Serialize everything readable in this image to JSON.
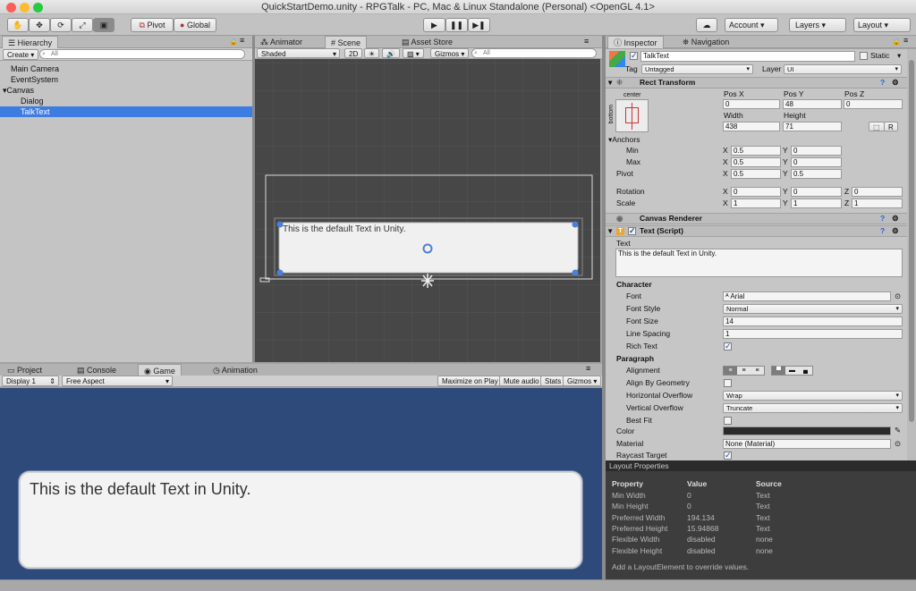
{
  "window": {
    "title": "QuickStartDemo.unity - RPGTalk - PC, Mac & Linux Standalone (Personal) <OpenGL 4.1>"
  },
  "toolbar": {
    "tools": [
      "hand-tool-icon",
      "move-tool-icon",
      "rotate-tool-icon",
      "scale-tool-icon",
      "rect-tool-icon"
    ],
    "pivot_label": "Pivot",
    "global_label": "Global",
    "play_icon": "▶",
    "pause_icon": "❚❚",
    "step_icon": "▶❚",
    "account_label": "Account",
    "layers_label": "Layers",
    "layout_label": "Layout"
  },
  "hierarchy": {
    "tab": "Hierarchy",
    "create_label": "Create",
    "search_placeholder": "All",
    "items": [
      {
        "label": "Main Camera"
      },
      {
        "label": "EventSystem"
      },
      {
        "label": "Canvas"
      },
      {
        "label": "Dialog"
      },
      {
        "label": "TalkText"
      }
    ]
  },
  "scene": {
    "tabs": [
      "Animator",
      "Scene",
      "Asset Store"
    ],
    "shading": "Shaded",
    "mode_2d": "2D",
    "gizmos_label": "Gizmos",
    "search_placeholder": "All",
    "text": "This is the default Text in Unity."
  },
  "bottom_tabs": [
    "Project",
    "Console",
    "Game",
    "Animation"
  ],
  "game": {
    "display": "Display 1",
    "aspect": "Free Aspect",
    "maximize": "Maximize on Play",
    "mute": "Mute audio",
    "stats": "Stats",
    "gizmos": "Gizmos",
    "text": "This is the default Text in Unity."
  },
  "inspector": {
    "tabs": [
      "Inspector",
      "Navigation"
    ],
    "object_name": "TalkText",
    "static_label": "Static",
    "tag_label": "Tag",
    "tag_value": "Untagged",
    "layer_label": "Layer",
    "layer_value": "UI",
    "rect_transform": {
      "title": "Rect Transform",
      "anchor_h": "center",
      "anchor_v": "bottom",
      "pos_x_label": "Pos X",
      "pos_y_label": "Pos Y",
      "pos_z_label": "Pos Z",
      "pos_x": "0",
      "pos_y": "48",
      "pos_z": "0",
      "width_label": "Width",
      "height_label": "Height",
      "width": "438",
      "height": "71",
      "r_label": "R",
      "anchors_label": "Anchors",
      "min_label": "Min",
      "max_label": "Max",
      "pivot_label": "Pivot",
      "min_x": "0.5",
      "min_y": "0",
      "max_x": "0.5",
      "max_y": "0",
      "pivot_x": "0.5",
      "pivot_y": "0.5",
      "rotation_label": "Rotation",
      "scale_label": "Scale",
      "rot_x": "0",
      "rot_y": "0",
      "rot_z": "0",
      "scale_x": "1",
      "scale_y": "1",
      "scale_z": "1",
      "x": "X",
      "y": "Y",
      "z": "Z"
    },
    "canvas_renderer": {
      "title": "Canvas Renderer"
    },
    "text_script": {
      "title": "Text (Script)",
      "text_label": "Text",
      "text_value": "This is the default Text in Unity.",
      "character_label": "Character",
      "font_label": "Font",
      "font_value": "Arial",
      "font_style_label": "Font Style",
      "font_style_value": "Normal",
      "font_size_label": "Font Size",
      "font_size_value": "14",
      "line_spacing_label": "Line Spacing",
      "line_spacing_value": "1",
      "rich_text_label": "Rich Text",
      "paragraph_label": "Paragraph",
      "alignment_label": "Alignment",
      "align_geometry_label": "Align By Geometry",
      "h_overflow_label": "Horizontal Overflow",
      "h_overflow_value": "Wrap",
      "v_overflow_label": "Vertical Overflow",
      "v_overflow_value": "Truncate",
      "best_fit_label": "Best Fit",
      "color_label": "Color",
      "color_value": "#2a2a2a",
      "material_label": "Material",
      "material_value": "None (Material)",
      "raycast_label": "Raycast Target"
    }
  },
  "layout_properties": {
    "title": "Layout Properties",
    "headers": [
      "Property",
      "Value",
      "Source"
    ],
    "rows": [
      [
        "Min Width",
        "0",
        "Text"
      ],
      [
        "Min Height",
        "0",
        "Text"
      ],
      [
        "Preferred Width",
        "194.134",
        "Text"
      ],
      [
        "Preferred Height",
        "15.94868",
        "Text"
      ],
      [
        "Flexible Width",
        "disabled",
        "none"
      ],
      [
        "Flexible Height",
        "disabled",
        "none"
      ]
    ],
    "footer": "Add a LayoutElement to override values."
  }
}
